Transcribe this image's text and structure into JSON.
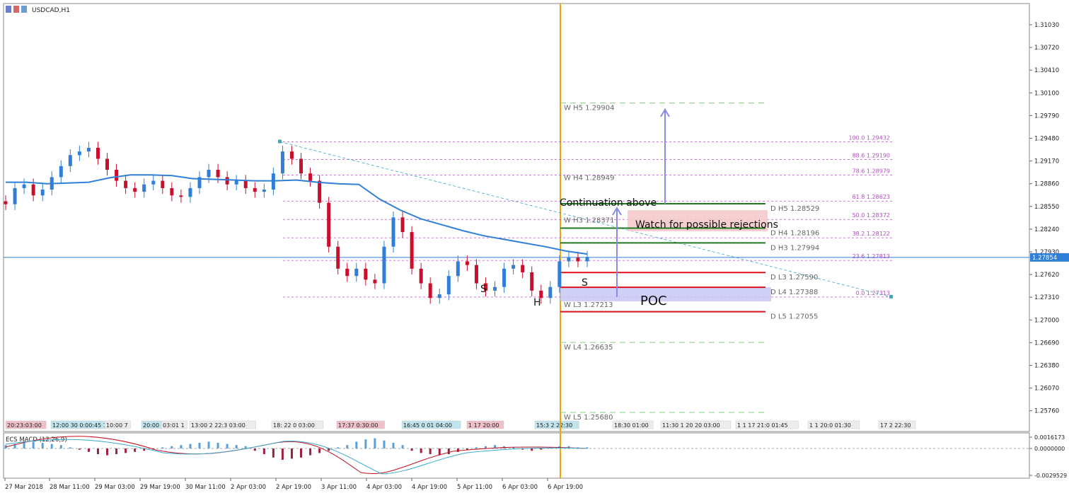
{
  "window": {
    "symbol_label": "USDCAD,H1",
    "icon": "window-icon"
  },
  "colors": {
    "candle_up": "#2f7fd8",
    "candle_down": "#c8102e",
    "ma": "#2f7fd8",
    "vline": "#f0a500",
    "fib": "#b04fc0",
    "green_level": "#1f7a1f",
    "red_level": "#e0101a",
    "trend": "#37a8c8",
    "price_line": "#2f7fd8",
    "price_tag_bg": "#2f7fd8",
    "poc_zone": "#c8c8f4",
    "rejection_zone": "#f4c8c8",
    "macd_pos": "#5aa0d8",
    "macd_neg": "#a02040",
    "macd_main": "#c01020",
    "macd_signal": "#3aaad0"
  },
  "price_axis": {
    "ticks": [
      "1.31030",
      "1.30720",
      "1.30410",
      "1.30100",
      "1.29790",
      "1.29480",
      "1.29170",
      "1.28860",
      "1.28550",
      "1.28240",
      "1.27930",
      "1.27620",
      "1.27310",
      "1.27000",
      "1.26690",
      "1.26380",
      "1.26070",
      "1.25760"
    ],
    "current_price": "1.27854"
  },
  "time_axis": {
    "labels": [
      "27 Mar 2018",
      "28 Mar 11:00",
      "29 Mar 03:00",
      "29 Mar 19:00",
      "30 Mar 11:00",
      "2 Apr 03:00",
      "2 Apr 19:00",
      "3 Apr 11:00",
      "4 Apr 03:00",
      "4 Apr 19:00",
      "5 Apr 11:00",
      "6 Apr 03:00",
      "6 Apr 19:00"
    ]
  },
  "session_tags": [
    {
      "text": "20:23:03:00",
      "style": "red"
    },
    {
      "text": "12:00 30 0:00:45 1",
      "style": "teal"
    },
    {
      "text": "10:00 7",
      "style": "plain"
    },
    {
      "text": "20:00",
      "style": "teal"
    },
    {
      "text": "03:01 1",
      "style": "plain"
    },
    {
      "text": "13:00 2 22:3 03:00",
      "style": "plain"
    },
    {
      "text": "18: 22 0 03:00",
      "style": "plain"
    },
    {
      "text": "17:37 0:30:00",
      "style": "red"
    },
    {
      "text": "16:45 0 01 04:00",
      "style": "teal"
    },
    {
      "text": "1 17 20:00",
      "style": "red"
    },
    {
      "text": "15:3 2 22:30",
      "style": "teal"
    },
    {
      "text": "18:30 01:00",
      "style": "plain"
    },
    {
      "text": "11:30 1 20 20 03:00",
      "style": "plain"
    },
    {
      "text": "1 1 17 21:0 01:45",
      "style": "plain"
    },
    {
      "text": "1 1 20:0 01:30",
      "style": "plain"
    },
    {
      "text": "17 2 22:30",
      "style": "plain"
    }
  ],
  "weekly_levels": [
    {
      "label": "W  H5 1.29904",
      "price": 1.29904,
      "style": "green-dashed"
    },
    {
      "label": "W  H4 1.28949",
      "price": 1.28949,
      "style": "none"
    },
    {
      "label": "W  H3 1.28371",
      "price": 1.28371,
      "style": "none"
    },
    {
      "label": "W  L3 1.27213",
      "price": 1.27213,
      "style": "none"
    },
    {
      "label": "W  L4 1.26635",
      "price": 1.26635,
      "style": "green-dashed"
    },
    {
      "label": "W  L5 1.25680",
      "price": 1.2568,
      "style": "green-dashed"
    }
  ],
  "daily_levels": [
    {
      "label": "D  H5 1.28529",
      "price": 1.28529,
      "color": "green"
    },
    {
      "label": "D  H4 1.28196",
      "price": 1.28196,
      "color": "green"
    },
    {
      "label": "D  H3 1.27994",
      "price": 1.27994,
      "color": "green"
    },
    {
      "label": "D  L3 1.27590",
      "price": 1.2759,
      "color": "red"
    },
    {
      "label": "D  L4 1.27388",
      "price": 1.27388,
      "color": "red"
    },
    {
      "label": "D  L5 1.27055",
      "price": 1.27055,
      "color": "red"
    }
  ],
  "fib_levels": [
    {
      "label": "100.0  1.29432",
      "price": 1.29432
    },
    {
      "label": "88.6  1.29190",
      "price": 1.2919
    },
    {
      "label": "78.6  1.28979",
      "price": 1.28979
    },
    {
      "label": "61.8  1.28623",
      "price": 1.28623
    },
    {
      "label": "50.0  1.28372",
      "price": 1.28372
    },
    {
      "label": "38.2  1.28122",
      "price": 1.28122
    },
    {
      "label": "23.6  1.27813",
      "price": 1.27813
    },
    {
      "label": "0.0  1.27313",
      "price": 1.27313
    }
  ],
  "annotations": {
    "continuation": "Continuation above",
    "rejections": "Watch for possible rejections",
    "poc": "POC",
    "pattern_left_shoulder": "S",
    "pattern_head": "H",
    "pattern_right_shoulder": "S"
  },
  "macd": {
    "label": "ECS MACD (12,26,9)",
    "ticks": [
      "0.0016173",
      "0.0000000",
      "-0.0029529"
    ]
  },
  "chart_data": {
    "type": "candlestick",
    "symbol": "USDCAD",
    "timeframe": "H1",
    "ylim": [
      1.2545,
      1.3128
    ],
    "x_start": "27 Mar 2018",
    "x_end": "6 Apr 2018",
    "series": [
      {
        "name": "price_close_approx",
        "values": [
          1.2858,
          1.288,
          1.2885,
          1.287,
          1.2878,
          1.2895,
          1.291,
          1.2925,
          1.293,
          1.2935,
          1.292,
          1.2905,
          1.289,
          1.288,
          1.2875,
          1.2885,
          1.289,
          1.288,
          1.287,
          1.2868,
          1.288,
          1.2895,
          1.2905,
          1.2895,
          1.2885,
          1.289,
          1.288,
          1.2875,
          1.2878,
          1.29,
          1.293,
          1.292,
          1.29,
          1.289,
          1.286,
          1.28,
          1.277,
          1.276,
          1.277,
          1.2755,
          1.275,
          1.28,
          1.284,
          1.282,
          1.277,
          1.275,
          1.273,
          1.2735,
          1.276,
          1.278,
          1.2775,
          1.275,
          1.274,
          1.2745,
          1.277,
          1.2775,
          1.2765,
          1.274,
          1.273,
          1.2745,
          1.278,
          1.2785,
          1.278,
          1.2786
        ]
      },
      {
        "name": "moving_average",
        "values": [
          1.2888,
          1.2888,
          1.2886,
          1.2887,
          1.2888,
          1.2894,
          1.2898,
          1.2898,
          1.2897,
          1.2893,
          1.2892,
          1.2891,
          1.289,
          1.289,
          1.2891,
          1.2888,
          1.2886,
          1.2885,
          1.2865,
          1.285,
          1.2838,
          1.283,
          1.2822,
          1.2815,
          1.281,
          1.2805,
          1.28,
          1.2794,
          1.279
        ]
      }
    ]
  }
}
